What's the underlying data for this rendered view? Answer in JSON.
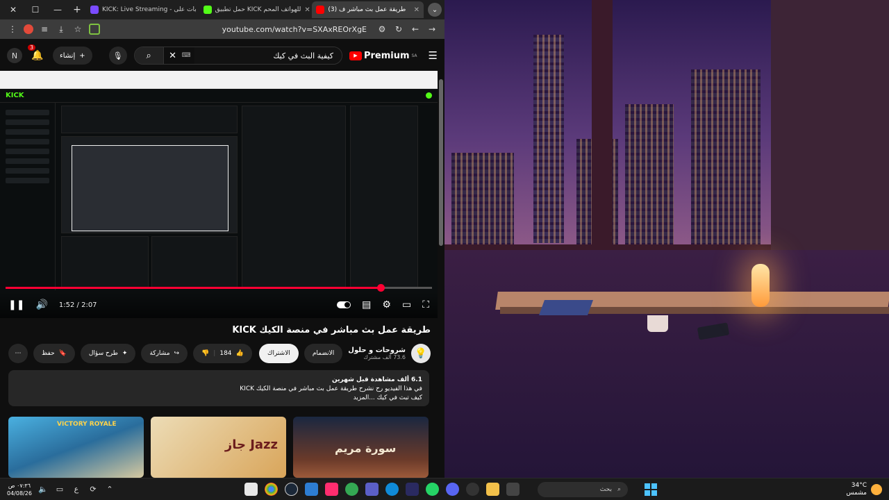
{
  "browser": {
    "tabs": [
      {
        "title": "(3) طريقة عمل بث مباشر ف",
        "active": true,
        "fav_color": "#ff0000"
      },
      {
        "title": "حمل تطبيق KICK للهواتف المحم",
        "active": false,
        "fav_color": "#53fc18"
      },
      {
        "title": "KICK: Live Streaming - بات على",
        "active": false,
        "fav_color": "#7a4bff"
      }
    ],
    "url": "youtube.com/watch?v=SXAxREOrXgE"
  },
  "yt": {
    "logo_text": "Premium",
    "logo_region": "SA",
    "search_value": "كيفية البث في كيك",
    "search_kbd": "⌨",
    "create_label": "إنشاء",
    "avatar_letter": "N",
    "notif_count": "3"
  },
  "video": {
    "kick_logo": "KICK",
    "time": "1:52 / 2:07",
    "progress": 0.88
  },
  "info": {
    "title": "طريقة عمل بث مباشر في منصة الكيك KICK",
    "channel_name": "شروحات و حلول",
    "channel_subs": "73.6 ألف مشترك",
    "join_label": "الانضمام",
    "subscribe_label": "الاشتراك",
    "likes": "184",
    "share_label": "مشاركة",
    "ask_label": "طرح سؤال",
    "save_label": "حفظ",
    "desc_stats": "6.1 ألف مشاهدة  قبل شهرين",
    "desc_line1": "في هذا الفيديو رح نشرح طريقة عمل بث مباشر في منصة الكيك KICK",
    "desc_line2": "كيف تبث في كيك ...المزيد"
  },
  "recs": [
    {
      "text": "VICTORY ROYALE",
      "color": "#ffd34a"
    },
    {
      "text": "جاز Jazz",
      "color": "#6b1c1c"
    },
    {
      "text": "سورة مريم",
      "color": "#f3e7d0"
    }
  ],
  "taskbar": {
    "time": "٠٧:٣٦ ص",
    "date": "04/08/26",
    "lang": "ع",
    "search_placeholder": "بحث",
    "temp": "34°C",
    "weather": "مشمس"
  }
}
